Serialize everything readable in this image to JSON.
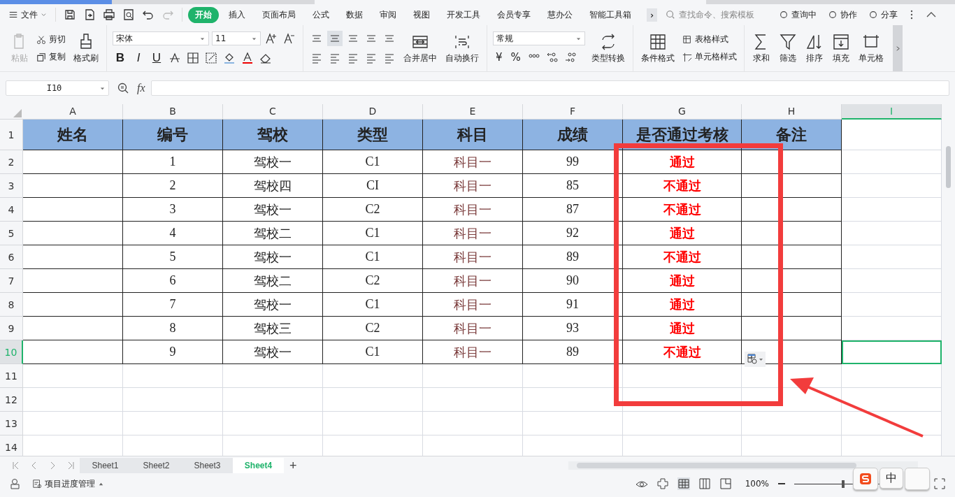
{
  "menu": {
    "file": "文件",
    "tabs": [
      {
        "label": "开始",
        "selected": true
      },
      {
        "label": "插入",
        "selected": false
      },
      {
        "label": "页面布局",
        "selected": false
      },
      {
        "label": "公式",
        "selected": false
      },
      {
        "label": "数据",
        "selected": false
      },
      {
        "label": "审阅",
        "selected": false
      },
      {
        "label": "视图",
        "selected": false
      },
      {
        "label": "开发工具",
        "selected": false
      },
      {
        "label": "会员专享",
        "selected": false
      },
      {
        "label": "慧办公",
        "selected": false
      },
      {
        "label": "智能工具箱",
        "selected": false
      }
    ],
    "more": "›",
    "search": {
      "placeholder": "查找命令、搜索模板"
    },
    "actions": [
      "查询中",
      "协作",
      "分享"
    ]
  },
  "ribbon": {
    "paste": {
      "label": "粘贴",
      "disabled": true
    },
    "cut": "剪切",
    "copy": "复制",
    "format_painter": "格式刷",
    "font": {
      "value": "宋体"
    },
    "size": {
      "value": "11"
    },
    "styles": [
      "B",
      "I",
      "U"
    ],
    "merge": "合并居中",
    "wrap": "自动换行",
    "number_format": {
      "value": "常规"
    },
    "currency": "¥",
    "percent": "%",
    "convert": "类型转换",
    "conditional": "条件格式",
    "table_style": "表格样式",
    "cell_style": "单元格样式",
    "large": [
      "求和",
      "筛选",
      "排序",
      "填充",
      "单元格"
    ]
  },
  "formula_bar": {
    "name_box": "I10",
    "fx": "fx"
  },
  "columns": [
    {
      "label": "A",
      "selected": false
    },
    {
      "label": "B",
      "selected": false
    },
    {
      "label": "C",
      "selected": false
    },
    {
      "label": "D",
      "selected": false
    },
    {
      "label": "E",
      "selected": false
    },
    {
      "label": "F",
      "selected": false
    },
    {
      "label": "G",
      "selected": false
    },
    {
      "label": "H",
      "selected": false
    },
    {
      "label": "I",
      "selected": true
    }
  ],
  "header": [
    "姓名",
    "编号",
    "驾校",
    "类型",
    "科目",
    "成绩",
    "是否通过考核",
    "备注"
  ],
  "rows": [
    {
      "num": "1",
      "selected": false,
      "cells": null
    },
    {
      "num": "2",
      "selected": false,
      "cells": [
        "",
        "1",
        "驾校一",
        "C1",
        "科目一",
        "99",
        "通过",
        ""
      ]
    },
    {
      "num": "3",
      "selected": false,
      "cells": [
        "",
        "2",
        "驾校四",
        "CI",
        "科目一",
        "85",
        "不通过",
        ""
      ]
    },
    {
      "num": "4",
      "selected": false,
      "cells": [
        "",
        "3",
        "驾校一",
        "C2",
        "科目一",
        "87",
        "不通过",
        ""
      ]
    },
    {
      "num": "5",
      "selected": false,
      "cells": [
        "",
        "4",
        "驾校二",
        "C1",
        "科目一",
        "92",
        "通过",
        ""
      ]
    },
    {
      "num": "6",
      "selected": false,
      "cells": [
        "",
        "5",
        "驾校一",
        "C1",
        "科目一",
        "89",
        "不通过",
        ""
      ]
    },
    {
      "num": "7",
      "selected": false,
      "cells": [
        "",
        "6",
        "驾校二",
        "C2",
        "科目一",
        "90",
        "通过",
        ""
      ]
    },
    {
      "num": "8",
      "selected": false,
      "cells": [
        "",
        "7",
        "驾校一",
        "C1",
        "科目一",
        "91",
        "通过",
        ""
      ]
    },
    {
      "num": "9",
      "selected": false,
      "cells": [
        "",
        "8",
        "驾校三",
        "C2",
        "科目一",
        "93",
        "通过",
        ""
      ]
    },
    {
      "num": "10",
      "selected": true,
      "cells": [
        "",
        "9",
        "驾校一",
        "C1",
        "科目一",
        "89",
        "不通过",
        ""
      ]
    },
    {
      "num": "11",
      "selected": false,
      "cells": []
    },
    {
      "num": "12",
      "selected": false,
      "cells": []
    },
    {
      "num": "13",
      "selected": false,
      "cells": []
    },
    {
      "num": "14",
      "selected": false,
      "cells": []
    }
  ],
  "sheets": [
    {
      "label": "Sheet1",
      "selected": false
    },
    {
      "label": "Sheet2",
      "selected": false
    },
    {
      "label": "Sheet3",
      "selected": false
    },
    {
      "label": "Sheet4",
      "selected": true
    }
  ],
  "add_sheet": "+",
  "status": {
    "project": "项目进度管理",
    "zoom": "100%",
    "zoom_slider": {
      "level": 0.45
    }
  },
  "ime": {
    "mode": "中"
  }
}
